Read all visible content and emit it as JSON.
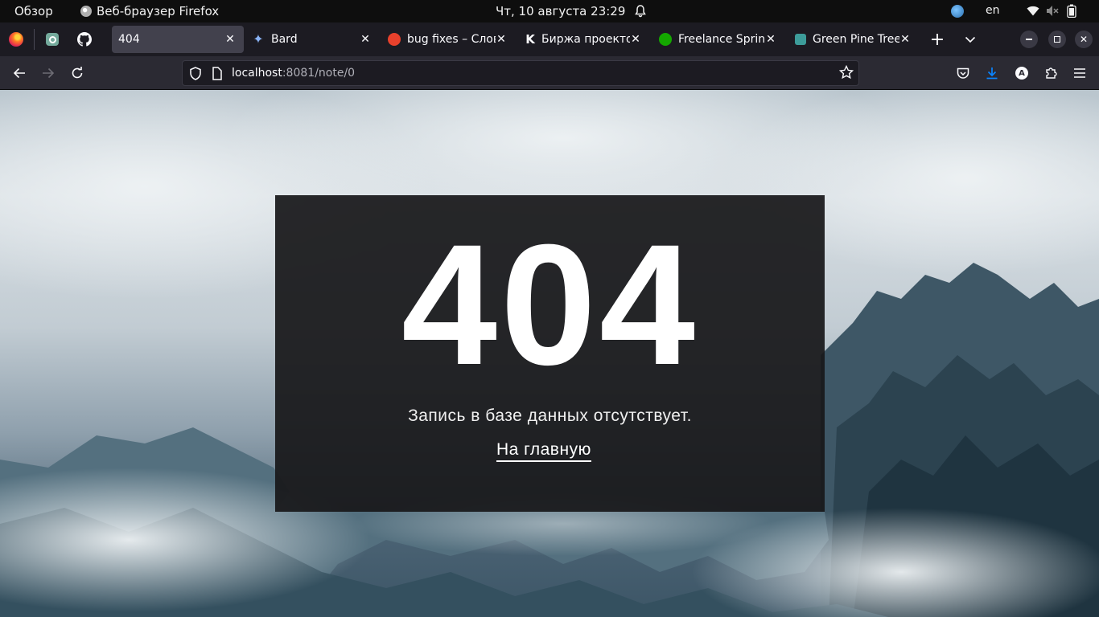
{
  "system_bar": {
    "overview": "Обзор",
    "app_name": "Веб-браузер Firefox",
    "datetime": "Чт, 10 августа  23:29",
    "keyboard_layout": "en"
  },
  "tabs": [
    {
      "label": "404",
      "active": true
    },
    {
      "label": "Bard",
      "active": false
    },
    {
      "label": "bug fixes – Слова",
      "active": false
    },
    {
      "label": "Биржа проектов",
      "active": false
    },
    {
      "label": "Freelance Spring",
      "active": false
    },
    {
      "label": "Green Pine Trees",
      "active": false
    }
  ],
  "url": {
    "host": "localhost",
    "path": ":8081/note/0"
  },
  "page": {
    "code": "404",
    "message": "Запись в базе данных отсутствует.",
    "home_link": "На главную"
  },
  "colors": {
    "accent": "#0060df",
    "panel": "#18181a"
  }
}
